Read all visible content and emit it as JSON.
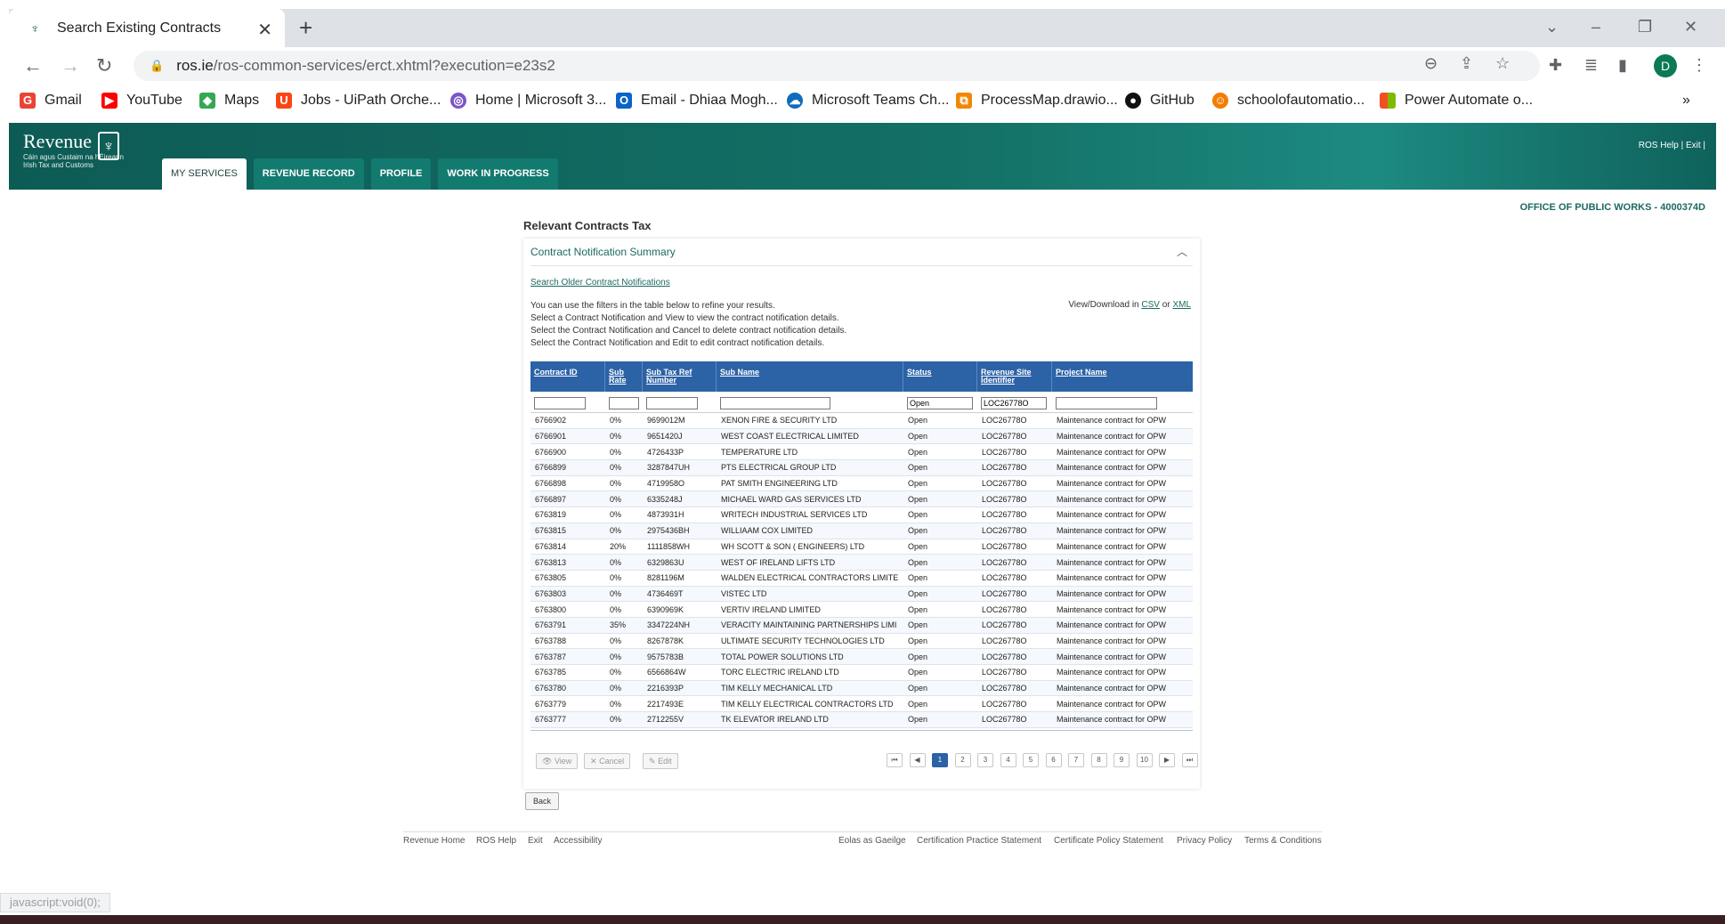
{
  "browser": {
    "tab_title": "Search Existing Contracts",
    "url_host": "ros.ie",
    "url_path": "/ros-common-services/erct.xhtml?execution=e23s2",
    "profile_initial": "D",
    "bookmarks": [
      {
        "label": "Gmail",
        "icon": "gmail-icon",
        "color": "#ea4335"
      },
      {
        "label": "YouTube",
        "icon": "youtube-icon",
        "color": "#ff0000"
      },
      {
        "label": "Maps",
        "icon": "maps-icon",
        "color": "#34a853"
      },
      {
        "label": "Jobs - UiPath Orche...",
        "icon": "uipath-icon",
        "color": "#fa4616"
      },
      {
        "label": "Home | Microsoft 3...",
        "icon": "microsoft365-icon",
        "color": "#7b56c7"
      },
      {
        "label": "Email - Dhiaa Mogh...",
        "icon": "outlook-icon",
        "color": "#0a64c8"
      },
      {
        "label": "Microsoft Teams Ch...",
        "icon": "onedrive-icon",
        "color": "#0f6cbd"
      },
      {
        "label": "ProcessMap.drawio...",
        "icon": "drawio-icon",
        "color": "#f08705"
      },
      {
        "label": "GitHub",
        "icon": "github-icon",
        "color": "#111111"
      },
      {
        "label": "schoolofautomatio...",
        "icon": "school-icon",
        "color": "#f57c00"
      },
      {
        "label": "Power Automate o...",
        "icon": "microsoft-icon",
        "color": "#f25022"
      }
    ]
  },
  "header": {
    "logo_main": "Revenue",
    "logo_sub1": "Cáin agus Custaim na hÉireann",
    "logo_sub2": "Irish Tax and Customs",
    "nav": [
      "MY SERVICES",
      "REVENUE RECORD",
      "PROFILE",
      "WORK IN PROGRESS"
    ],
    "links": "ROS Help | Exit |"
  },
  "org_id": "OFFICE OF PUBLIC WORKS - 4000374D",
  "main": {
    "title": "Relevant Contracts Tax",
    "panel_title": "Contract Notification Summary",
    "older_link": "Search Older Contract Notifications",
    "instructions": [
      "You can use the filters in the table below to refine your results.",
      "Select a Contract Notification and View to view the contract notification details.",
      "Select the Contract Notification and Cancel to delete contract notification details.",
      "Select the Contract Notification and Edit to edit contract notification details."
    ],
    "download_prefix": "View/Download in",
    "download_csv": "CSV",
    "download_or": "or",
    "download_xml": "XML"
  },
  "table": {
    "headers": [
      [
        "Contract ID"
      ],
      [
        "Sub",
        "Rate"
      ],
      [
        "Sub Tax Ref",
        "Number"
      ],
      [
        "Sub Name"
      ],
      [
        "Status"
      ],
      [
        "Revenue Site",
        "Identifier"
      ],
      [
        "Project Name"
      ]
    ],
    "filters": [
      "",
      "",
      "",
      "",
      "Open",
      "LOC26778O",
      ""
    ],
    "rows": [
      [
        "6766902",
        "0%",
        "9699012M",
        "XENON FIRE & SECURITY LTD",
        "Open",
        "LOC26778O",
        "Maintenance contract for OPW"
      ],
      [
        "6766901",
        "0%",
        "9651420J",
        "WEST COAST ELECTRICAL LIMITED",
        "Open",
        "LOC26778O",
        "Maintenance contract for OPW"
      ],
      [
        "6766900",
        "0%",
        "4726433P",
        "TEMPERATURE LTD",
        "Open",
        "LOC26778O",
        "Maintenance contract for OPW"
      ],
      [
        "6766899",
        "0%",
        "3287847UH",
        "PTS ELECTRICAL GROUP LTD",
        "Open",
        "LOC26778O",
        "Maintenance contract for OPW"
      ],
      [
        "6766898",
        "0%",
        "4719958O",
        "PAT SMITH ENGINEERING LTD",
        "Open",
        "LOC26778O",
        "Maintenance contract for OPW"
      ],
      [
        "6766897",
        "0%",
        "6335248J",
        "MICHAEL WARD GAS SERVICES LTD",
        "Open",
        "LOC26778O",
        "Maintenance contract for OPW"
      ],
      [
        "6763819",
        "0%",
        "4873931H",
        "WRITECH INDUSTRIAL SERVICES LTD",
        "Open",
        "LOC26778O",
        "Maintenance contract for OPW"
      ],
      [
        "6763815",
        "0%",
        "2975436BH",
        "WILLIAAM COX LIMITED",
        "Open",
        "LOC26778O",
        "Maintenance contract for OPW"
      ],
      [
        "6763814",
        "20%",
        "1111858WH",
        "WH SCOTT & SON ( ENGINEERS) LTD",
        "Open",
        "LOC26778O",
        "Maintenance contract for OPW"
      ],
      [
        "6763813",
        "0%",
        "6329863U",
        "WEST OF IRELAND LIFTS LTD",
        "Open",
        "LOC26778O",
        "Maintenance contract for OPW"
      ],
      [
        "6763805",
        "0%",
        "8281196M",
        "WALDEN ELECTRICAL CONTRACTORS LIMITE",
        "Open",
        "LOC26778O",
        "Maintenance contract for OPW"
      ],
      [
        "6763803",
        "0%",
        "4736469T",
        "VISTEC LTD",
        "Open",
        "LOC26778O",
        "Maintenance contract for OPW"
      ],
      [
        "6763800",
        "0%",
        "6390969K",
        "VERTIV IRELAND LIMITED",
        "Open",
        "LOC26778O",
        "Maintenance contract for OPW"
      ],
      [
        "6763791",
        "35%",
        "3347224NH",
        "VERACITY MAINTAINING PARTNERSHIPS LIMI",
        "Open",
        "LOC26778O",
        "Maintenance contract for OPW"
      ],
      [
        "6763788",
        "0%",
        "8267878K",
        "ULTIMATE SECURITY TECHNOLOGIES LTD",
        "Open",
        "LOC26778O",
        "Maintenance contract for OPW"
      ],
      [
        "6763787",
        "0%",
        "9575783B",
        "TOTAL POWER SOLUTIONS LTD",
        "Open",
        "LOC26778O",
        "Maintenance contract for OPW"
      ],
      [
        "6763785",
        "0%",
        "6566864W",
        "TORC ELECTRIC IRELAND LTD",
        "Open",
        "LOC26778O",
        "Maintenance contract for OPW"
      ],
      [
        "6763780",
        "0%",
        "2216393P",
        "TIM KELLY MECHANICAL LTD",
        "Open",
        "LOC26778O",
        "Maintenance contract for OPW"
      ],
      [
        "6763779",
        "0%",
        "2217493E",
        "TIM KELLY ELECTRICAL CONTRACTORS LTD",
        "Open",
        "LOC26778O",
        "Maintenance contract for OPW"
      ],
      [
        "6763777",
        "0%",
        "2712255V",
        "TK ELEVATOR IRELAND LTD",
        "Open",
        "LOC26778O",
        "Maintenance contract for OPW"
      ]
    ]
  },
  "actions": {
    "view": "View",
    "cancel": "Cancel",
    "edit": "Edit",
    "back": "Back"
  },
  "pagination": {
    "pages": [
      "1",
      "2",
      "3",
      "4",
      "5",
      "6",
      "7",
      "8",
      "9",
      "10"
    ],
    "current": "1"
  },
  "footer": {
    "left": [
      "Revenue Home",
      "ROS Help",
      "Exit",
      "Accessibility"
    ],
    "right": [
      "Eolas as Gaeilge",
      "Certification Practice Statement",
      "Certificate Policy Statement",
      "Privacy Policy",
      "Terms & Conditions"
    ]
  },
  "status_bar": "javascript:void(0);",
  "colors": {
    "brand": "#0d5b55",
    "grid_header": "#2c62a6",
    "link": "#1c6a62"
  }
}
